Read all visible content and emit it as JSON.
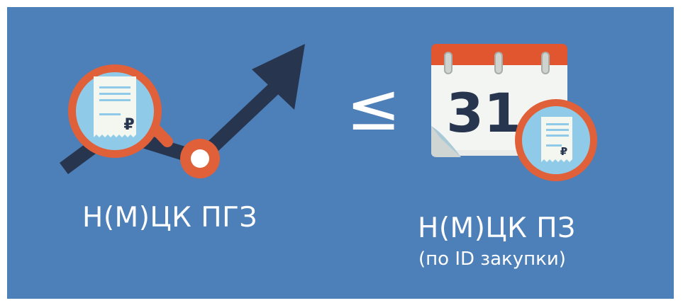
{
  "left": {
    "label": "Н(М)ЦК ПГЗ",
    "illustration": {
      "icons": [
        "trend-arrow-icon",
        "magnifier-icon",
        "receipt-icon",
        "ruble-icon",
        "chart-point-icon"
      ],
      "currency_symbol": "₽"
    }
  },
  "comparison": {
    "operator": "≤"
  },
  "right": {
    "label": "Н(М)ЦК ПЗ",
    "sublabel": "(по ID закупки)",
    "calendar": {
      "day": "31",
      "icons": [
        "calendar-icon",
        "receipt-icon",
        "ruble-icon"
      ]
    },
    "currency_symbol": "₽"
  },
  "colors": {
    "background": "#4d7fb8",
    "arrow": "#27354f",
    "orange": "#e0603a",
    "light_blue": "#8fcbe8",
    "paper": "#f3f7ef",
    "calendar_red": "#e2562f",
    "text": "#ffffff"
  }
}
